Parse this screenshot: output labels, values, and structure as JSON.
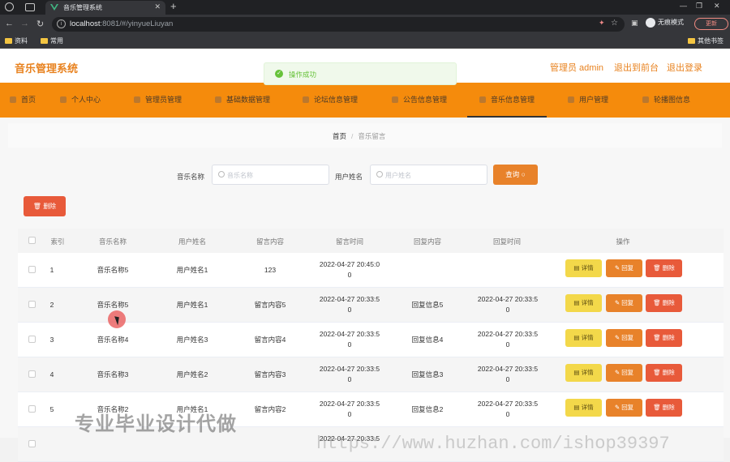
{
  "browser": {
    "tab_title": "音乐管理系统",
    "url_host": "localhost",
    "url_rest": ":8081/#/yinyueLiuyan",
    "profile_label": "无痕模式",
    "update_label": "更新",
    "bookmarks": [
      "资料",
      "常用"
    ],
    "other_bookmarks": "其他书签"
  },
  "header": {
    "brand": "音乐管理系统",
    "admin": "管理员 admin",
    "to_front": "退出到前台",
    "logout": "退出登录"
  },
  "toast": {
    "message": "操作成功"
  },
  "menu": [
    {
      "label": "首页"
    },
    {
      "label": "个人中心"
    },
    {
      "label": "管理员管理"
    },
    {
      "label": "基础数据管理"
    },
    {
      "label": "论坛信息管理"
    },
    {
      "label": "公告信息管理"
    },
    {
      "label": "音乐信息管理"
    },
    {
      "label": "用户管理"
    },
    {
      "label": "轮播图信息"
    }
  ],
  "breadcrumb": {
    "home": "首页",
    "current": "音乐留言"
  },
  "search": {
    "music_label": "音乐名称",
    "music_placeholder": "音乐名称",
    "user_label": "用户姓名",
    "user_placeholder": "用户姓名",
    "query_label": "查询"
  },
  "delete_label": "删除",
  "table": {
    "headers": [
      "索引",
      "音乐名称",
      "用户姓名",
      "留言内容",
      "留言时间",
      "回复内容",
      "回复时间",
      "操作"
    ],
    "actions": {
      "detail": "详情",
      "reply": "回复",
      "remove": "删除"
    },
    "rows": [
      {
        "index": "1",
        "music": "音乐名称5",
        "user": "用户姓名1",
        "content": "123",
        "time": "2022-04-27 20:45:0\n0",
        "reply": "",
        "reply_time": ""
      },
      {
        "index": "2",
        "music": "音乐名称5",
        "user": "用户姓名1",
        "content": "留言内容5",
        "time": "2022-04-27 20:33:5\n0",
        "reply": "回复信息5",
        "reply_time": "2022-04-27 20:33:5\n0"
      },
      {
        "index": "3",
        "music": "音乐名称4",
        "user": "用户姓名3",
        "content": "留言内容4",
        "time": "2022-04-27 20:33:5\n0",
        "reply": "回复信息4",
        "reply_time": "2022-04-27 20:33:5\n0"
      },
      {
        "index": "4",
        "music": "音乐名称3",
        "user": "用户姓名2",
        "content": "留言内容3",
        "time": "2022-04-27 20:33:5\n0",
        "reply": "回复信息3",
        "reply_time": "2022-04-27 20:33:5\n0"
      },
      {
        "index": "5",
        "music": "音乐名称2",
        "user": "用户姓名1",
        "content": "留言内容2",
        "time": "2022-04-27 20:33:5\n0",
        "reply": "回复信息2",
        "reply_time": "2022-04-27 20:33:5\n0"
      },
      {
        "index": "",
        "music": "",
        "user": "",
        "content": "",
        "time": "2022-04-27 20:33:5",
        "reply": "",
        "reply_time": ""
      }
    ]
  },
  "watermark": {
    "main": "专业毕业设计代做",
    "url": "https://www.huzhan.com/ishop39397"
  },
  "colors": {
    "accent": "#f58b0c",
    "brand": "#e8821f",
    "danger": "#e85a3a",
    "warning": "#f3d84a",
    "success": "#67c23a"
  }
}
